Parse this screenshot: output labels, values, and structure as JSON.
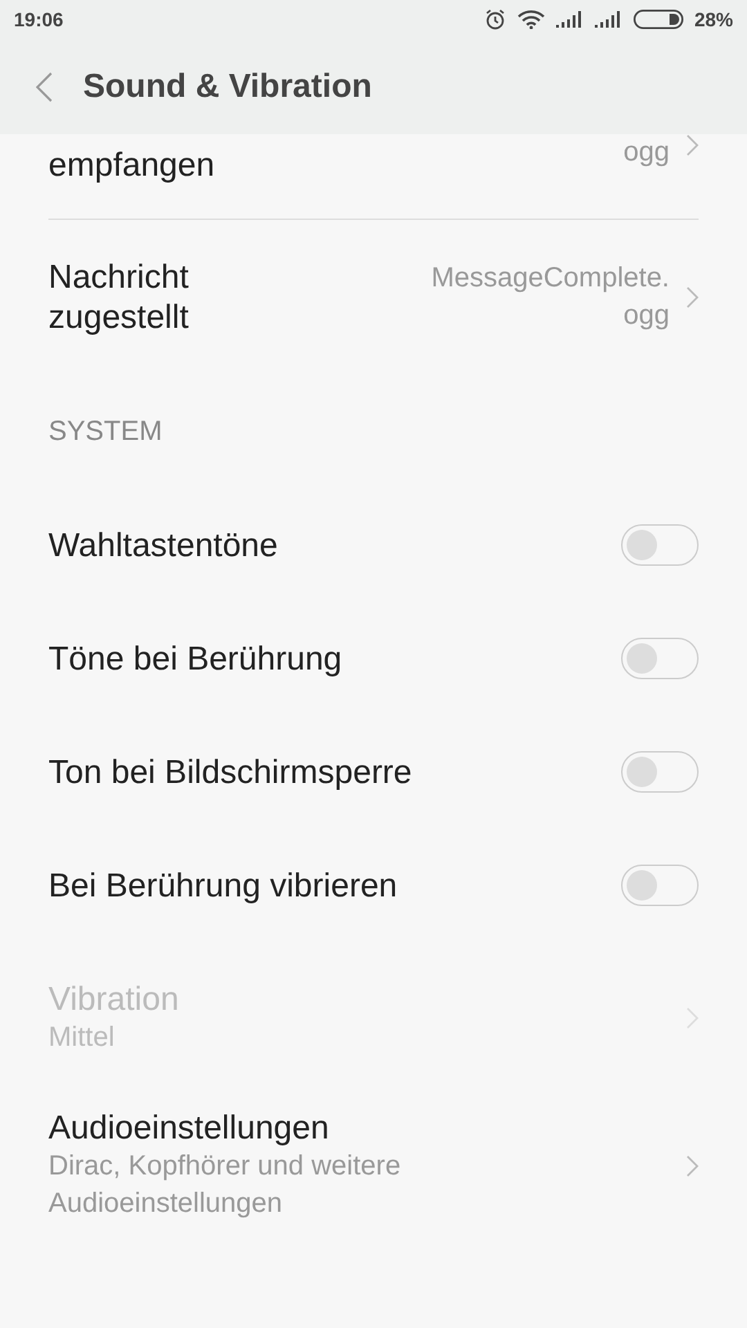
{
  "status_bar": {
    "time": "19:06",
    "battery": "28%"
  },
  "header": {
    "title": "Sound & Vibration"
  },
  "items": [
    {
      "kind": "link",
      "title": "empfangen",
      "value_lines": [
        "ogg"
      ],
      "disabled": false,
      "partial": true
    },
    {
      "kind": "link",
      "title": "Nachricht zugestellt",
      "value_lines": [
        "MessageComplete.",
        "ogg"
      ],
      "disabled": false
    },
    {
      "kind": "section",
      "title": "SYSTEM"
    },
    {
      "kind": "toggle",
      "title": "Wahltastentöne",
      "on": false
    },
    {
      "kind": "toggle",
      "title": "Töne bei Berührung",
      "on": false
    },
    {
      "kind": "toggle",
      "title": "Ton bei Bildschirmsperre",
      "on": false
    },
    {
      "kind": "toggle",
      "title": "Bei Berührung vibrieren",
      "on": false
    },
    {
      "kind": "link",
      "title": "Vibration",
      "subtitle": "Mittel",
      "disabled": true
    },
    {
      "kind": "link",
      "title": "Audioeinstellungen",
      "subtitle": "Dirac, Kopfhörer und weitere Audioeinstellungen",
      "disabled": false
    }
  ]
}
